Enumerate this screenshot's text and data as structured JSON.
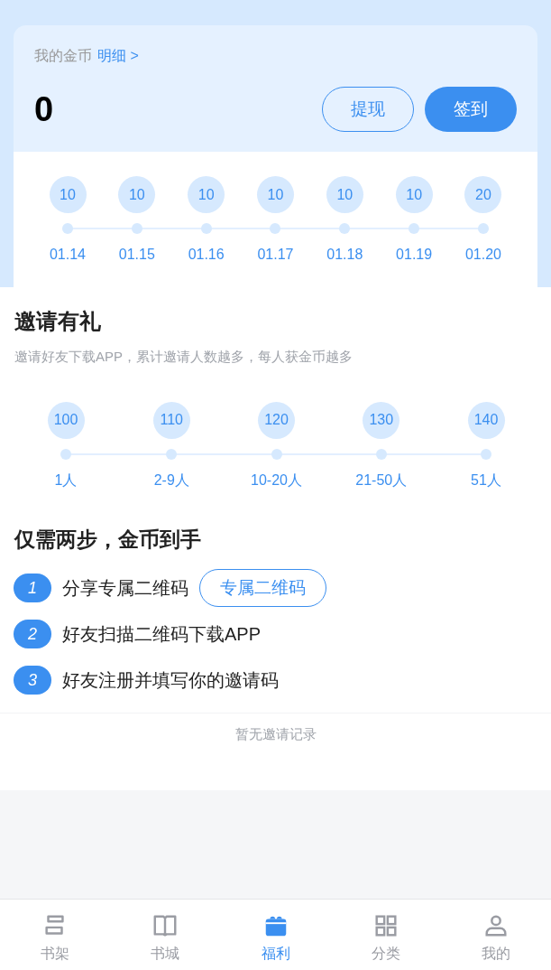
{
  "coins": {
    "label": "我的金币",
    "detail_link": "明细 >",
    "amount": "0",
    "buttons": [
      {
        "label": "提现",
        "kind": "outline"
      },
      {
        "label": "签到",
        "kind": "filled"
      }
    ],
    "checkin": [
      {
        "reward": "10",
        "date": "01.14"
      },
      {
        "reward": "10",
        "date": "01.15"
      },
      {
        "reward": "10",
        "date": "01.16"
      },
      {
        "reward": "10",
        "date": "01.17"
      },
      {
        "reward": "10",
        "date": "01.18"
      },
      {
        "reward": "10",
        "date": "01.19"
      },
      {
        "reward": "20",
        "date": "01.20"
      }
    ]
  },
  "invite": {
    "title": "邀请有礼",
    "subtitle": "邀请好友下载APP，累计邀请人数越多，每人获金币越多",
    "tiers": [
      {
        "reward": "100",
        "range": "1人"
      },
      {
        "reward": "110",
        "range": "2-9人"
      },
      {
        "reward": "120",
        "range": "10-20人"
      },
      {
        "reward": "130",
        "range": "21-50人"
      },
      {
        "reward": "140",
        "range": "51人"
      }
    ]
  },
  "steps": {
    "title": "仅需两步，金币到手",
    "items": [
      {
        "number": "1",
        "text": "分享专属二维码",
        "button": "专属二维码"
      },
      {
        "number": "2",
        "text": "好友扫描二维码下载APP"
      },
      {
        "number": "3",
        "text": "好友注册并填写你的邀请码"
      }
    ],
    "empty_note": "暂无邀请记录"
  },
  "tab_bar": [
    {
      "label": "书架",
      "selected": false
    },
    {
      "label": "书城",
      "selected": false
    },
    {
      "label": "福利",
      "selected": true
    },
    {
      "label": "分类",
      "selected": false
    },
    {
      "label": "我的",
      "selected": false
    }
  ]
}
